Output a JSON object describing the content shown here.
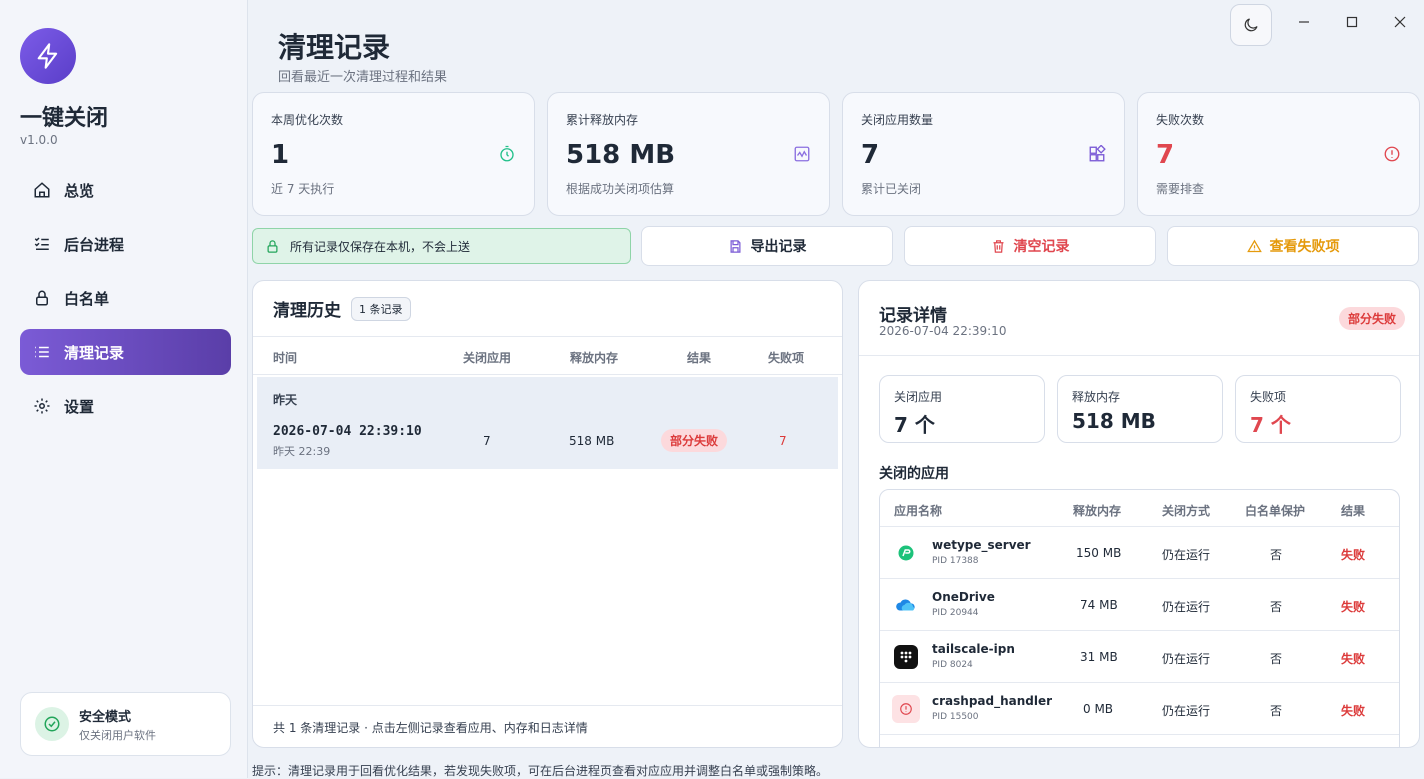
{
  "app": {
    "name": "一键关闭",
    "version": "v1.0.0"
  },
  "nav": [
    {
      "label": "总览",
      "icon": "home-icon"
    },
    {
      "label": "后台进程",
      "icon": "process-list-icon"
    },
    {
      "label": "白名单",
      "icon": "lock-icon"
    },
    {
      "label": "清理记录",
      "icon": "list-icon",
      "active": true
    },
    {
      "label": "设置",
      "icon": "gear-icon"
    }
  ],
  "safe_mode": {
    "title": "安全模式",
    "subtitle": "仅关闭用户软件"
  },
  "page": {
    "title": "清理记录",
    "subtitle": "回看最近一次清理过程和结果"
  },
  "stats": [
    {
      "label": "本周优化次数",
      "value": "1",
      "sub": "近 7 天执行",
      "icon": "timer-icon",
      "color": "#1f2937"
    },
    {
      "label": "累计释放内存",
      "value": "518 MB",
      "sub": "根据成功关闭项估算",
      "icon": "activity-icon",
      "color": "#1f2937"
    },
    {
      "label": "关闭应用数量",
      "value": "7",
      "sub": "累计已关闭",
      "icon": "apps-icon",
      "color": "#1f2937"
    },
    {
      "label": "失败次数",
      "value": "7",
      "sub": "需要排查",
      "icon": "alert-circle-icon",
      "color": "#e0474f"
    }
  ],
  "notice": "所有记录仅保存在本机，不会上送",
  "actions": {
    "export": "导出记录",
    "clear": "清空记录",
    "view_failed": "查看失败项"
  },
  "history": {
    "title": "清理历史",
    "badge": "1 条记录",
    "columns": [
      "时间",
      "关闭应用",
      "释放内存",
      "结果",
      "失败项"
    ],
    "group": "昨天",
    "row": {
      "timestamp": "2026-07-04 22:39:10",
      "relative": "昨天 22:39",
      "closed": "7",
      "memory": "518 MB",
      "result": "部分失败",
      "failed": "7"
    },
    "footer": "共 1 条清理记录 · 点击左侧记录查看应用、内存和日志详情"
  },
  "detail": {
    "title": "记录详情",
    "date": "2026-07-04 22:39:10",
    "status": "部分失败",
    "mini": [
      {
        "label": "关闭应用",
        "value": "7 个"
      },
      {
        "label": "释放内存",
        "value": "518 MB"
      },
      {
        "label": "失败项",
        "value": "7 个"
      }
    ],
    "section": "关闭的应用",
    "columns": [
      "应用名称",
      "释放内存",
      "关闭方式",
      "白名单保护",
      "结果"
    ],
    "apps": [
      {
        "name": "wetype_server",
        "pid": "PID 17388",
        "memory": "150 MB",
        "method": "仍在运行",
        "whitelist": "否",
        "result": "失败",
        "icon": "wetype-icon"
      },
      {
        "name": "OneDrive",
        "pid": "PID 20944",
        "memory": "74 MB",
        "method": "仍在运行",
        "whitelist": "否",
        "result": "失败",
        "icon": "cloud-icon"
      },
      {
        "name": "tailscale-ipn",
        "pid": "PID 8024",
        "memory": "31 MB",
        "method": "仍在运行",
        "whitelist": "否",
        "result": "失败",
        "icon": "tailscale-icon"
      },
      {
        "name": "crashpad_handler",
        "pid": "PID 15500",
        "memory": "0 MB",
        "method": "仍在运行",
        "whitelist": "否",
        "result": "失败",
        "icon": "warning-circle-icon"
      }
    ]
  },
  "tip": "提示：清理记录用于回看优化结果，若发现失败项，可在后台进程页查看对应应用并调整白名单或强制策略。"
}
